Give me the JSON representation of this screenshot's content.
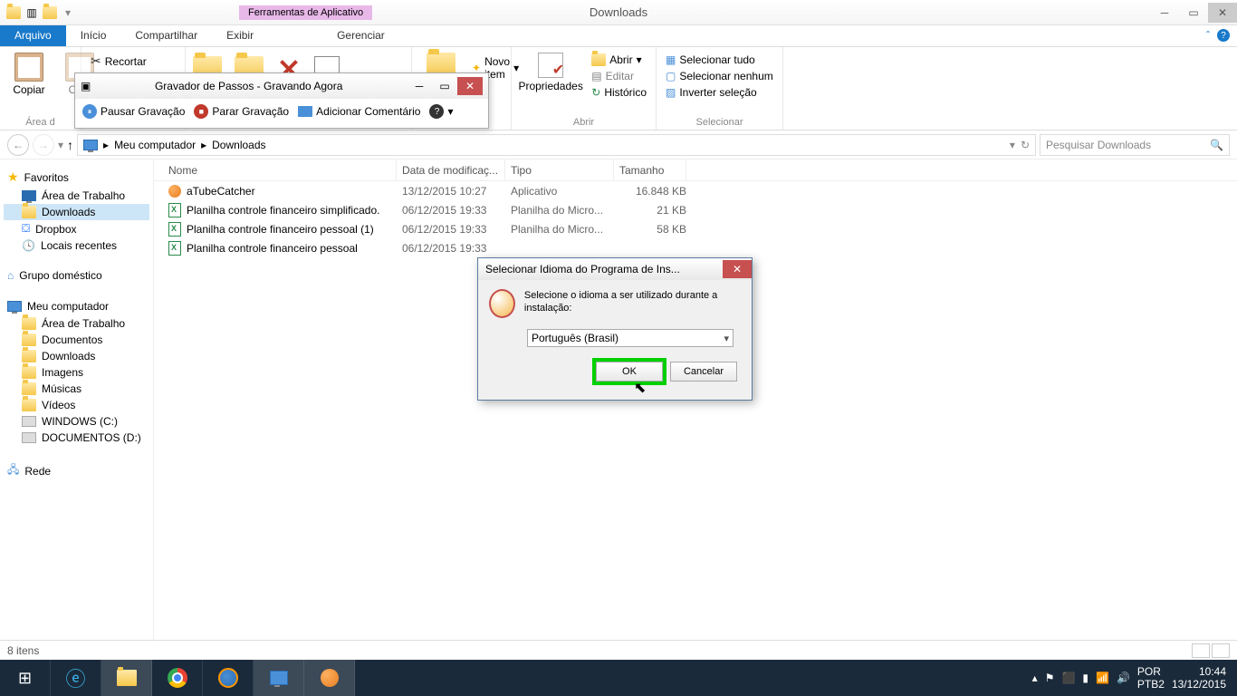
{
  "titlebar": {
    "contextTab": "Ferramentas de Aplicativo",
    "title": "Downloads"
  },
  "ribbonTabs": {
    "file": "Arquivo",
    "home": "Início",
    "share": "Compartilhar",
    "view": "Exibir",
    "manage": "Gerenciar"
  },
  "ribbon": {
    "copy": "Copiar",
    "paste": "Cola",
    "cut": "Recortar",
    "clipboardGroup": "Área d",
    "newItem": "Novo item",
    "properties": "Propriedades",
    "open": "Abrir",
    "edit": "Editar",
    "history": "Histórico",
    "openGroup": "Abrir",
    "selectAll": "Selecionar tudo",
    "selectNone": "Selecionar nenhum",
    "invertSel": "Inverter seleção",
    "selectGroup": "Selecionar"
  },
  "address": {
    "myComputer": "Meu computador",
    "downloads": "Downloads",
    "searchPlaceholder": "Pesquisar Downloads"
  },
  "sidebar": {
    "favorites": "Favoritos",
    "desktop": "Área de Trabalho",
    "downloads": "Downloads",
    "dropbox": "Dropbox",
    "recent": "Locais recentes",
    "homegroup": "Grupo doméstico",
    "computer": "Meu computador",
    "desktop2": "Área de Trabalho",
    "documents": "Documentos",
    "downloads2": "Downloads",
    "images": "Imagens",
    "music": "Músicas",
    "videos": "Vídeos",
    "driveC": "WINDOWS (C:)",
    "driveD": "DOCUMENTOS (D:)",
    "network": "Rede"
  },
  "columns": {
    "name": "Nome",
    "date": "Data de modificaç...",
    "type": "Tipo",
    "size": "Tamanho"
  },
  "files": [
    {
      "name": "aTubeCatcher",
      "date": "13/12/2015 10:27",
      "type": "Aplicativo",
      "size": "16.848 KB",
      "icon": "orange"
    },
    {
      "name": "Planilha controle financeiro simplificado.",
      "date": "06/12/2015 19:33",
      "type": "Planilha do Micro...",
      "size": "21 KB",
      "icon": "xls"
    },
    {
      "name": "Planilha controle financeiro pessoal (1)",
      "date": "06/12/2015 19:33",
      "type": "Planilha do Micro...",
      "size": "58 KB",
      "icon": "xls"
    },
    {
      "name": "Planilha controle financeiro pessoal",
      "date": "06/12/2015 19:33",
      "type": "",
      "size": "",
      "icon": "xls"
    }
  ],
  "status": {
    "count": "8 itens"
  },
  "psr": {
    "title": "Gravador de Passos - Gravando Agora",
    "pause": "Pausar Gravação",
    "stop": "Parar Gravação",
    "comment": "Adicionar Comentário"
  },
  "dialog": {
    "title": "Selecionar Idioma do Programa de Ins...",
    "text": "Selecione o idioma a ser utilizado durante a instalação:",
    "selected": "Português (Brasil)",
    "ok": "OK",
    "cancel": "Cancelar"
  },
  "taskbar": {
    "lang": "POR",
    "kbd": "PTB2",
    "time": "10:44",
    "date": "13/12/2015"
  }
}
